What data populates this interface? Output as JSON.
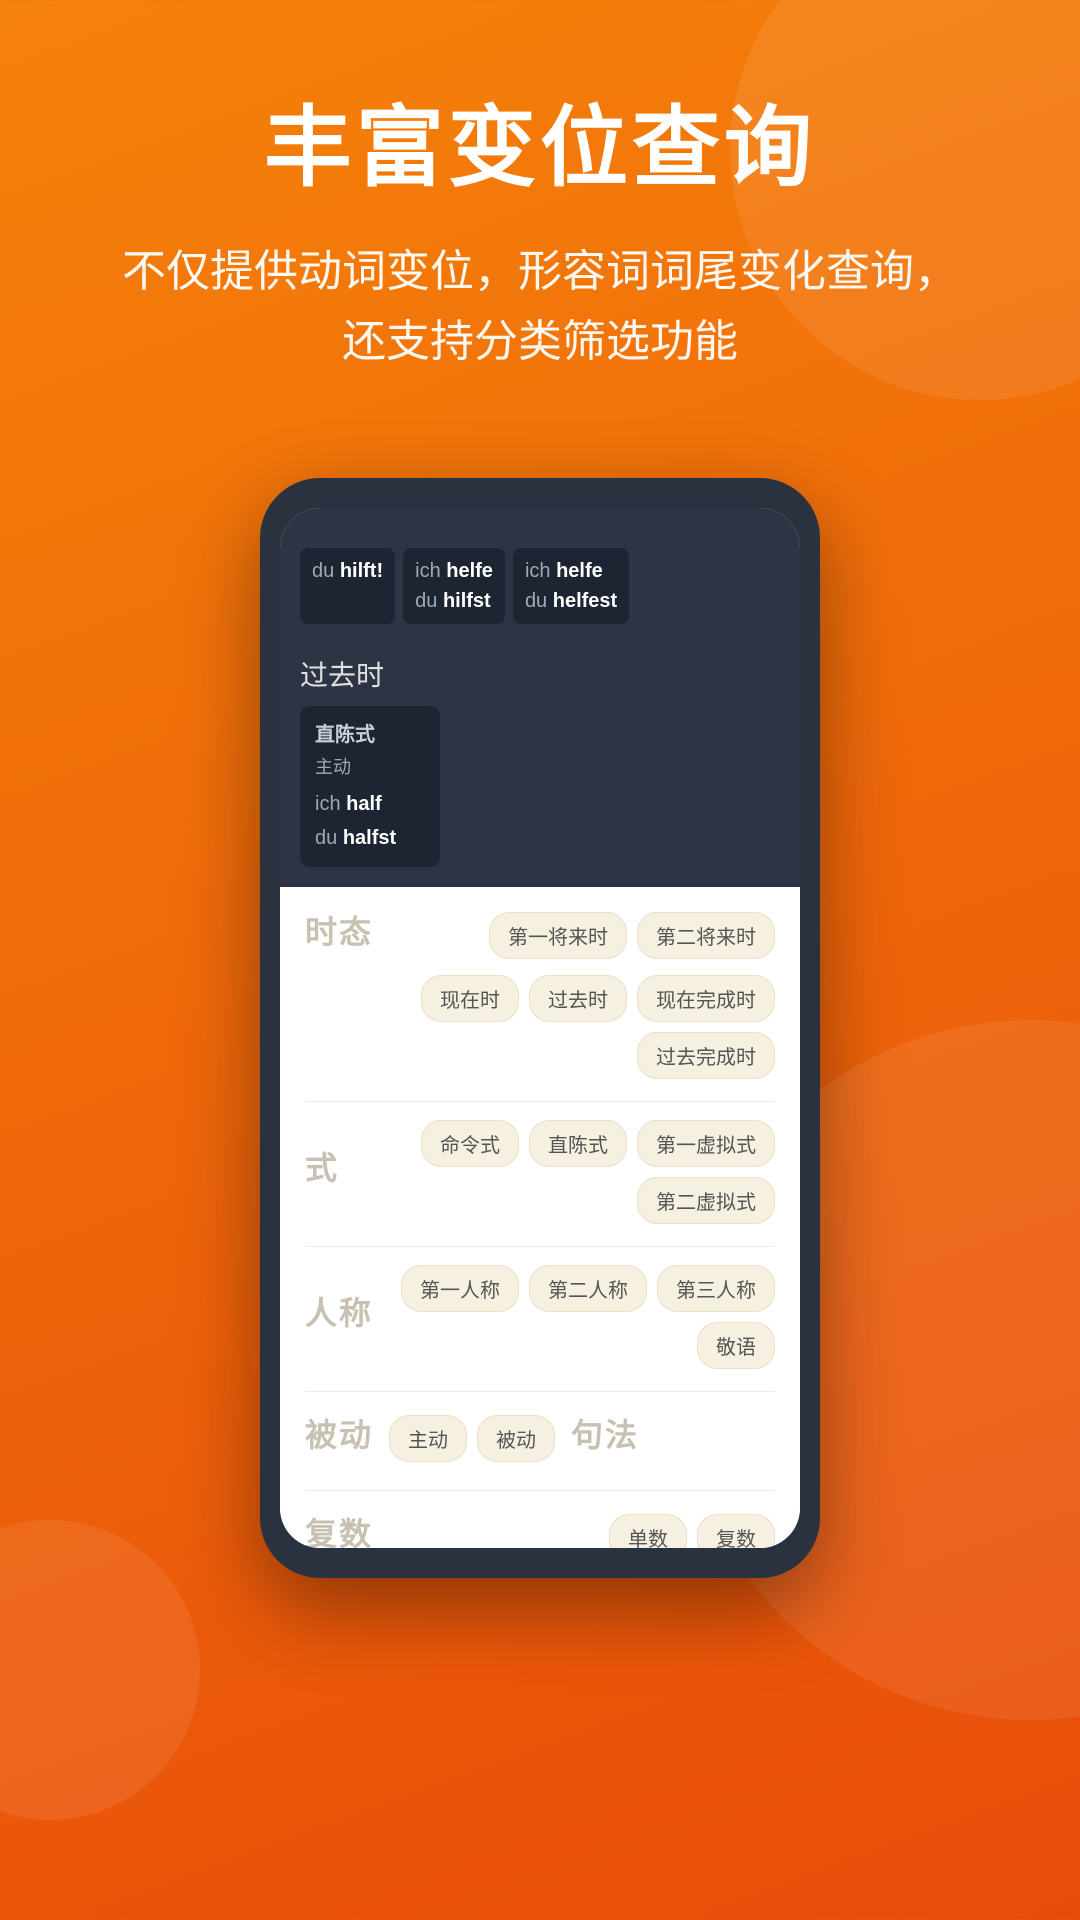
{
  "header": {
    "main_title": "丰富变位查询",
    "subtitle_line1": "不仅提供动词变位，形容词词尾变化查询，",
    "subtitle_line2": "还支持分类筛选功能"
  },
  "phone": {
    "dark_section": {
      "tooltips": [
        {
          "pronoun": "du",
          "verb": "hilft!",
          "id": "t1"
        },
        {
          "pronoun": "ich",
          "verb_line1": "helfe",
          "pronoun2": "du",
          "verb_line2": "hilfst",
          "id": "t2"
        },
        {
          "pronoun": "ich",
          "verb_line1": "helfe",
          "pronoun2": "du",
          "verb_line2": "helfest",
          "id": "t3"
        }
      ],
      "past_tense_label": "过去时",
      "conj_box": {
        "label": "直陈式",
        "sub_label": "主动",
        "forms": [
          {
            "pronoun": "ich",
            "verb": "half"
          },
          {
            "pronoun": "du",
            "verb": "halfst"
          }
        ]
      }
    },
    "filters": {
      "tense": {
        "label": "时态",
        "tags": [
          {
            "text": "第一将来时",
            "active": false
          },
          {
            "text": "第二将来时",
            "active": false
          },
          {
            "text": "现在时",
            "active": false
          },
          {
            "text": "过去时",
            "active": false
          },
          {
            "text": "现在完成时",
            "active": false
          },
          {
            "text": "过去完成时",
            "active": false
          }
        ]
      },
      "mode": {
        "label": "式",
        "tags": [
          {
            "text": "命令式",
            "active": false
          },
          {
            "text": "直陈式",
            "active": false
          },
          {
            "text": "第一虚拟式",
            "active": false
          },
          {
            "text": "第二虚拟式",
            "active": false
          }
        ]
      },
      "person": {
        "label": "人称",
        "tags": [
          {
            "text": "第一人称",
            "active": false
          },
          {
            "text": "第二人称",
            "active": false
          },
          {
            "text": "第三人称",
            "active": false
          },
          {
            "text": "敬语",
            "active": false
          }
        ]
      },
      "voice": {
        "label": "被动",
        "tags": [
          {
            "text": "主动",
            "active": false
          },
          {
            "text": "被动",
            "active": false
          }
        ]
      },
      "sentence": {
        "label": "句法"
      },
      "number": {
        "label": "复数",
        "tags": [
          {
            "text": "单数",
            "active": false
          },
          {
            "text": "复数",
            "active": false
          }
        ]
      }
    }
  }
}
